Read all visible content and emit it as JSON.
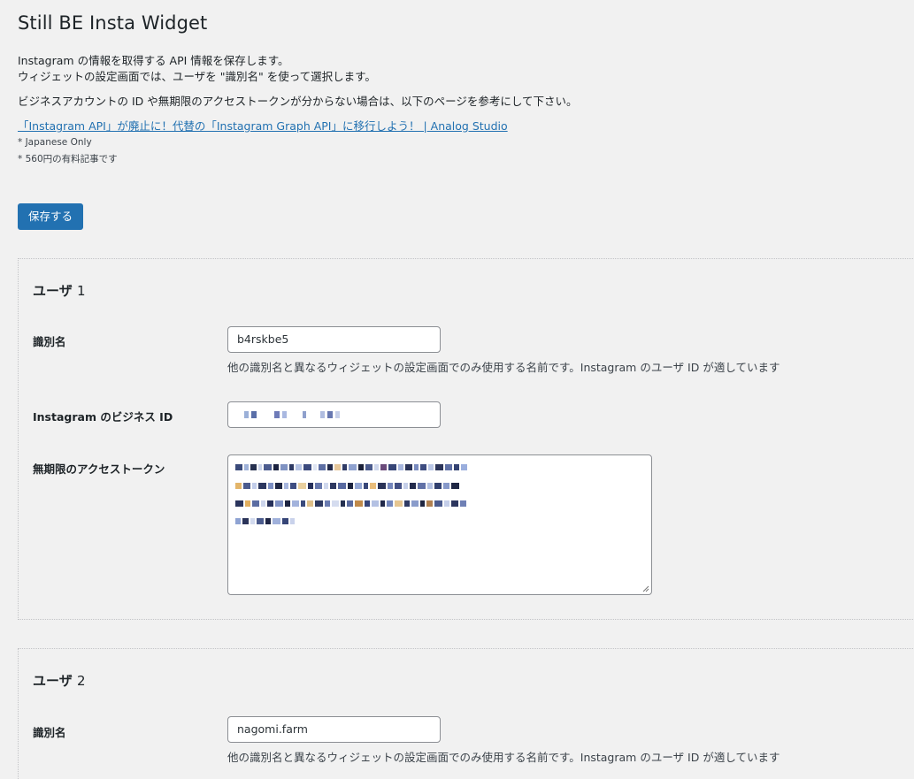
{
  "page": {
    "title": "Still BE Insta Widget"
  },
  "intro": {
    "line1": "Instagram の情報を取得する API 情報を保存します。",
    "line2": "ウィジェットの設定画面では、ユーザを \"識別名\" を使って選択します。",
    "line3": "ビジネスアカウントの ID や無期限のアクセストークンが分からない場合は、以下のページを参考にして下さい。",
    "link_text": "「Instagram API」が廃止に！代替の「Instagram Graph API」に移行しよう！ | Analog Studio",
    "note1": "* Japanese Only",
    "note2": "* 560円の有料記事です"
  },
  "toolbar": {
    "save_label": "保存する"
  },
  "users": [
    {
      "heading": "ユーザ",
      "number": "1",
      "id_label": "識別名",
      "id_value": "b4rskbe5",
      "id_desc": "他の識別名と異なるウィジェットの設定画面でのみ使用する名前です。Instagram のユーザ ID が適しています",
      "business_id_label": "Instagram のビジネス ID",
      "token_label": "無期限のアクセストークン"
    },
    {
      "heading": "ユーザ",
      "number": "2",
      "id_label": "識別名",
      "id_value": "nagomi.farm",
      "id_desc": "他の識別名と異なるウィジェットの設定画面でのみ使用する名前です。Instagram のユーザ ID が適しています"
    }
  ],
  "colors": {
    "accent": "#2271b1",
    "background": "#f1f1f1",
    "text": "#1d2327"
  }
}
